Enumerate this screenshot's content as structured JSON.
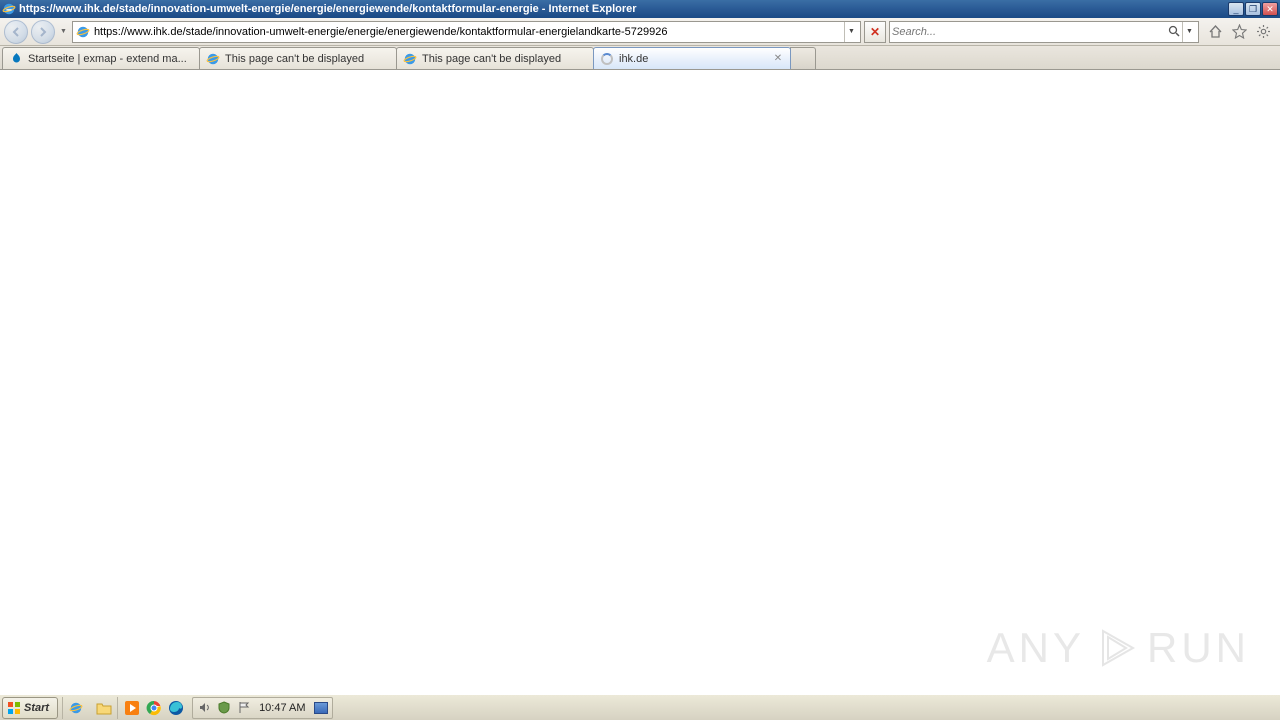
{
  "window": {
    "title": "https://www.ihk.de/stade/innovation-umwelt-energie/energie/energiewende/kontaktformular-energie - Internet Explorer"
  },
  "address_bar": {
    "url": "https://www.ihk.de/stade/innovation-umwelt-energie/energie/energiewende/kontaktformular-energielandkarte-5729926"
  },
  "search": {
    "placeholder": "Search..."
  },
  "tabs": [
    {
      "label": "Startseite | exmap - extend ma...",
      "icon": "drupal"
    },
    {
      "label": "This page can't be displayed",
      "icon": "ie"
    },
    {
      "label": "This page can't be displayed",
      "icon": "ie"
    },
    {
      "label": "ihk.de",
      "icon": "loading",
      "active": true,
      "closable": true
    }
  ],
  "watermark": {
    "left": "ANY",
    "right": "RUN"
  },
  "taskbar": {
    "start_label": "Start",
    "clock": "10:47 AM"
  }
}
